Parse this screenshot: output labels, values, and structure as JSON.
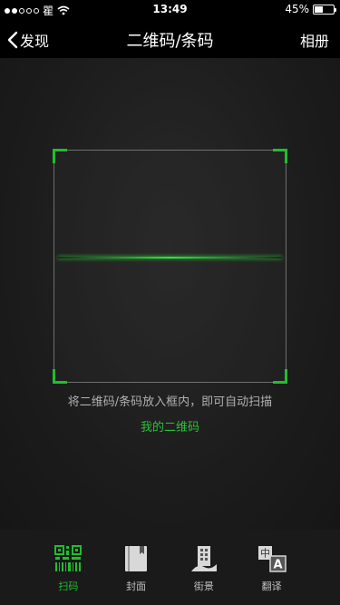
{
  "status_bar": {
    "carrier": "瞿",
    "time": "13:49",
    "battery": "45%",
    "battery_level": 0.45
  },
  "nav": {
    "back_label": "发现",
    "title": "二维码/条码",
    "right_label": "相册"
  },
  "scanner": {
    "hint": "将二维码/条码放入框内，即可自动扫描",
    "my_qr_link": "我的二维码"
  },
  "tabs": [
    {
      "label": "扫码",
      "icon": "qr-scan-icon",
      "active": true
    },
    {
      "label": "封面",
      "icon": "book-cover-icon",
      "active": false
    },
    {
      "label": "街景",
      "icon": "street-view-icon",
      "active": false
    },
    {
      "label": "翻译",
      "icon": "translate-icon",
      "active": false
    }
  ],
  "colors": {
    "accent": "#1fbe2d",
    "background": "#000000",
    "tabbar": "#1a1a1a"
  }
}
